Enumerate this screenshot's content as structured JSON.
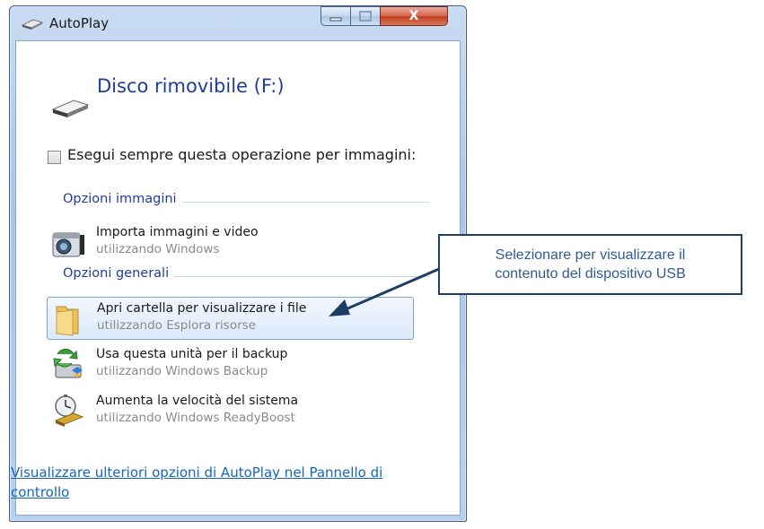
{
  "window": {
    "title": "AutoPlay",
    "minimize_icon": "minimize-icon",
    "maximize_icon": "maximize-icon",
    "close_icon": "close-icon",
    "close_label": "X"
  },
  "device": {
    "name": "Disco rimovibile (F:)",
    "icon": "removable-drive-icon"
  },
  "always": {
    "label": "Esegui sempre questa operazione per immagini:",
    "checked": false
  },
  "groups": [
    {
      "heading": "Opzioni immagini",
      "options": [
        {
          "title": "Importa immagini e video",
          "subtitle": "utilizzando Windows",
          "icon": "camera-icon"
        }
      ]
    },
    {
      "heading": "Opzioni generali",
      "options": [
        {
          "title": "Apri cartella per visualizzare i file",
          "subtitle": "utilizzando Esplora risorse",
          "icon": "folder-icon",
          "selected": true
        },
        {
          "title": "Usa questa unità per il backup",
          "subtitle": "utilizzando Windows Backup",
          "icon": "backup-icon"
        },
        {
          "title": "Aumenta la velocità del sistema",
          "subtitle": "utilizzando Windows ReadyBoost",
          "icon": "readyboost-icon"
        }
      ]
    }
  ],
  "more_link": "Visualizzare ulteriori opzioni di AutoPlay nel Pannello di controllo",
  "callout": {
    "line1": "Selezionare per visualizzare il",
    "line2": "contenuto del dispositivo USB"
  },
  "colors": {
    "heading_blue": "#1f3d9a",
    "link_blue": "#1565c0",
    "callout_border": "#1f3e63",
    "callout_text": "#2f5b93",
    "close_red": "#c0401f"
  }
}
